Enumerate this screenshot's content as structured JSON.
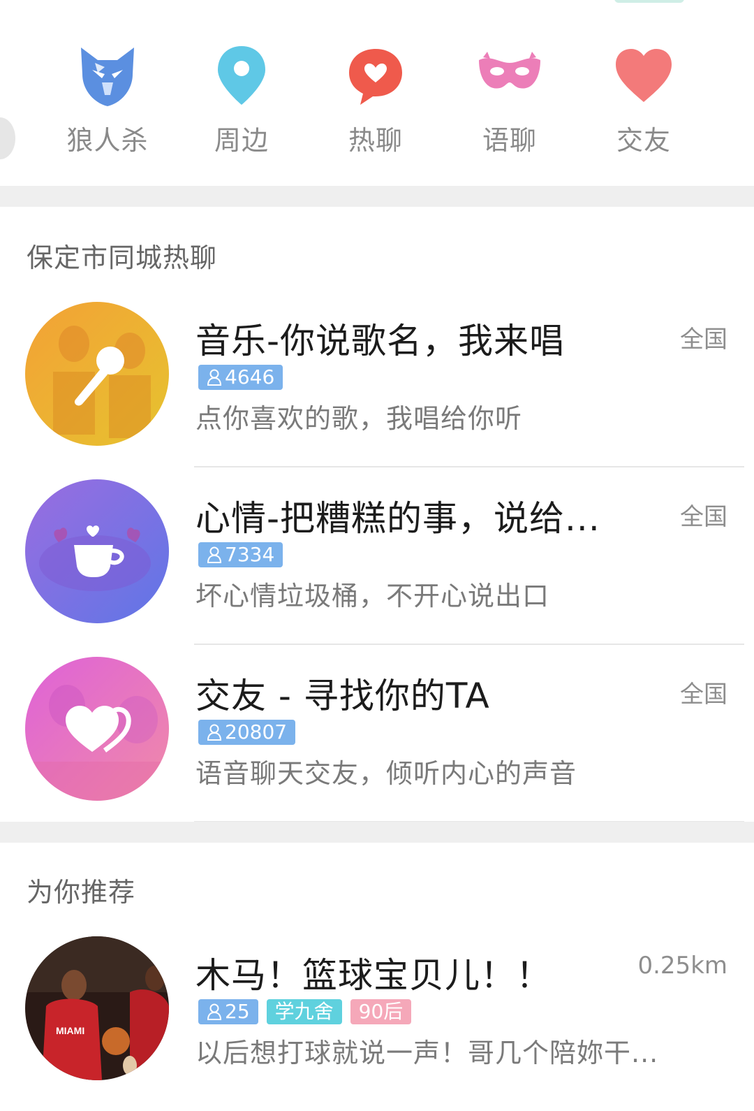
{
  "categories": [
    {
      "label": "狼人杀",
      "icon": "wolf-icon",
      "color": "#5b8fe0"
    },
    {
      "label": "周边",
      "icon": "location-pin-icon",
      "color": "#5fc8e6"
    },
    {
      "label": "热聊",
      "icon": "chat-heart-icon",
      "color": "#ef5a4c"
    },
    {
      "label": "语聊",
      "icon": "mask-icon",
      "color": "#ec7eb8"
    },
    {
      "label": "交友",
      "icon": "heart-icon",
      "color": "#f37a7a"
    }
  ],
  "local_section": {
    "title": "保定市同城热聊",
    "items": [
      {
        "title": "音乐-你说歌名，我来唱",
        "scope": "全国",
        "count": "4646",
        "desc": "点你喜欢的歌，我唱给你听",
        "icon": "microphone-icon"
      },
      {
        "title": "心情-把糟糕的事，说给...",
        "scope": "全国",
        "count": "7334",
        "desc": "坏心情垃圾桶，不开心说出口",
        "icon": "coffee-cup-heart-icon"
      },
      {
        "title": "交友 - 寻找你的TA",
        "scope": "全国",
        "count": "20807",
        "desc": "语音聊天交友，倾听内心的声音",
        "icon": "double-heart-icon"
      }
    ]
  },
  "recommend_section": {
    "title": "为你推荐",
    "items": [
      {
        "title": "木马！篮球宝贝儿！！",
        "distance": "0.25km",
        "count": "25",
        "school": "学九舍",
        "age": "90后",
        "desc": "以后想打球就说一声！哥几个陪妳干..."
      }
    ]
  }
}
